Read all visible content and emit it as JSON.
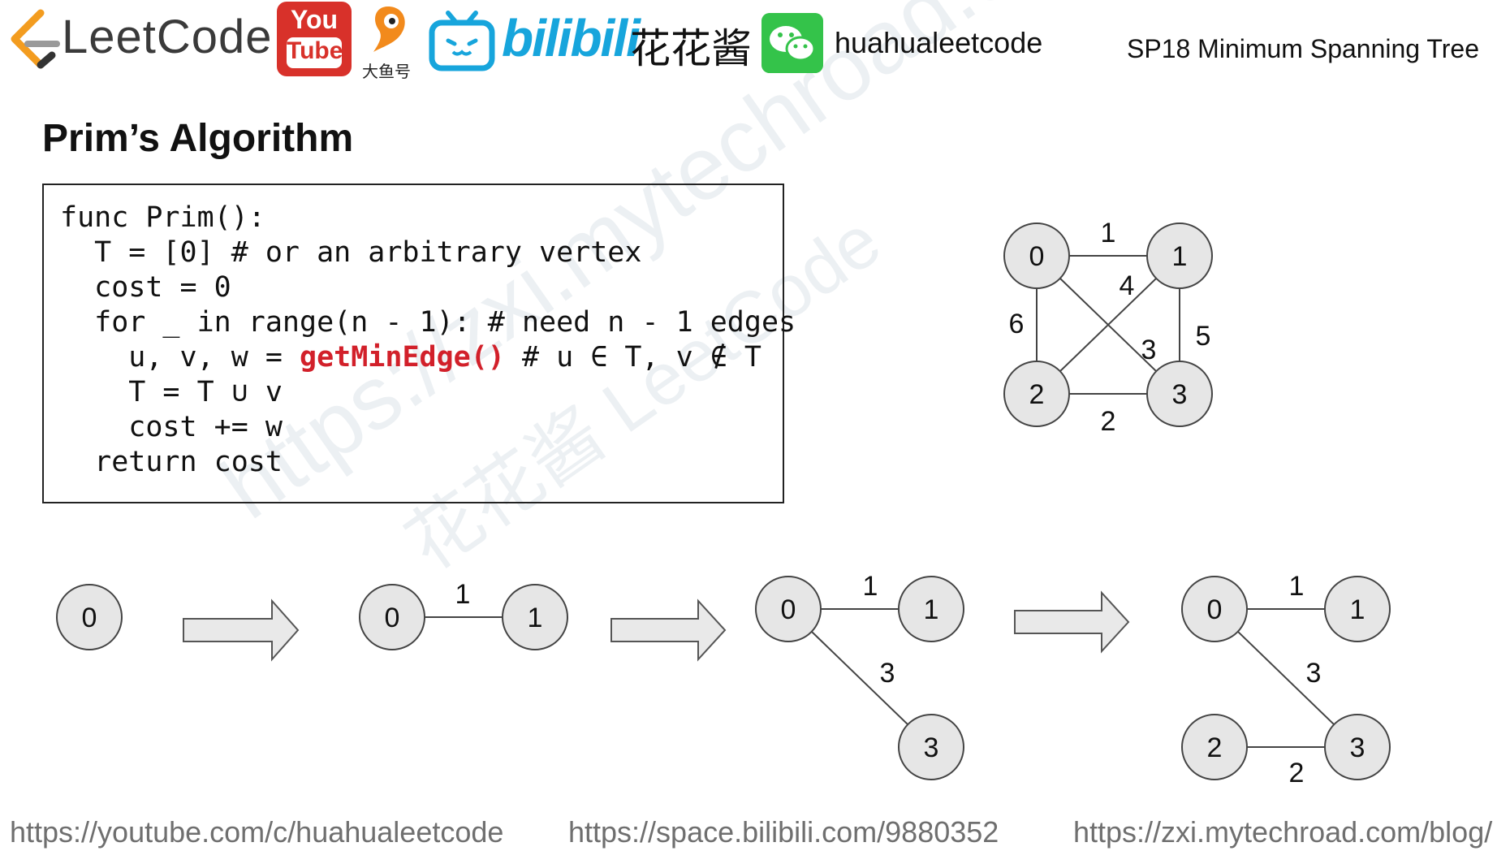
{
  "header": {
    "brand": "LeetCode",
    "youtube_top": "You",
    "youtube_bottom": "Tube",
    "douyu": "大鱼号",
    "bilibili": "bilibili",
    "name_cn": "花花酱",
    "handle": "huahualeetcode",
    "slide_title": "SP18 Minimum Spanning Tree"
  },
  "heading": "Prim’s Algorithm",
  "code": {
    "line1": "func Prim():",
    "line2": "  T = [0] # or an arbitrary vertex",
    "line3": "  cost = 0",
    "line4": "  for _ in range(n - 1): # need n - 1 edges",
    "line5_pre": "    u, v, w = ",
    "line5_call": "getMinEdge()",
    "line5_post": " # u ∈ T, v ∉ T",
    "line6": "    T = T ∪ v",
    "line7": "    cost += w",
    "line8": "  return cost"
  },
  "main_graph": {
    "nodes": [
      "0",
      "1",
      "2",
      "3"
    ],
    "edge_weights": {
      "e01": "1",
      "e03": "3",
      "e12": "4",
      "e13": "5",
      "e02": "6",
      "e23": "2"
    }
  },
  "steps": [
    {
      "nodes": [
        "0"
      ]
    },
    {
      "nodes": [
        "0",
        "1"
      ],
      "weights": [
        "1"
      ]
    },
    {
      "nodes": [
        "0",
        "1",
        "3"
      ],
      "weights": [
        "1",
        "3"
      ]
    },
    {
      "nodes": [
        "0",
        "1",
        "2",
        "3"
      ],
      "weights": [
        "1",
        "3",
        "2"
      ]
    }
  ],
  "watermark": {
    "text": "https://zxi.mytechroad.com/blog/",
    "text2": "花花酱 LeetCode"
  },
  "footer": {
    "youtube": "https://youtube.com/c/huahualeetcode",
    "bilibili": "https://space.bilibili.com/9880352",
    "blog": "https://zxi.mytechroad.com/blog/"
  },
  "colors": {
    "node_fill": "#e6e6e6",
    "node_stroke": "#444444",
    "code_highlight": "#d2202a",
    "youtube": "#d8312a",
    "bilibili": "#17a5dc",
    "wechat": "#34c34a"
  }
}
